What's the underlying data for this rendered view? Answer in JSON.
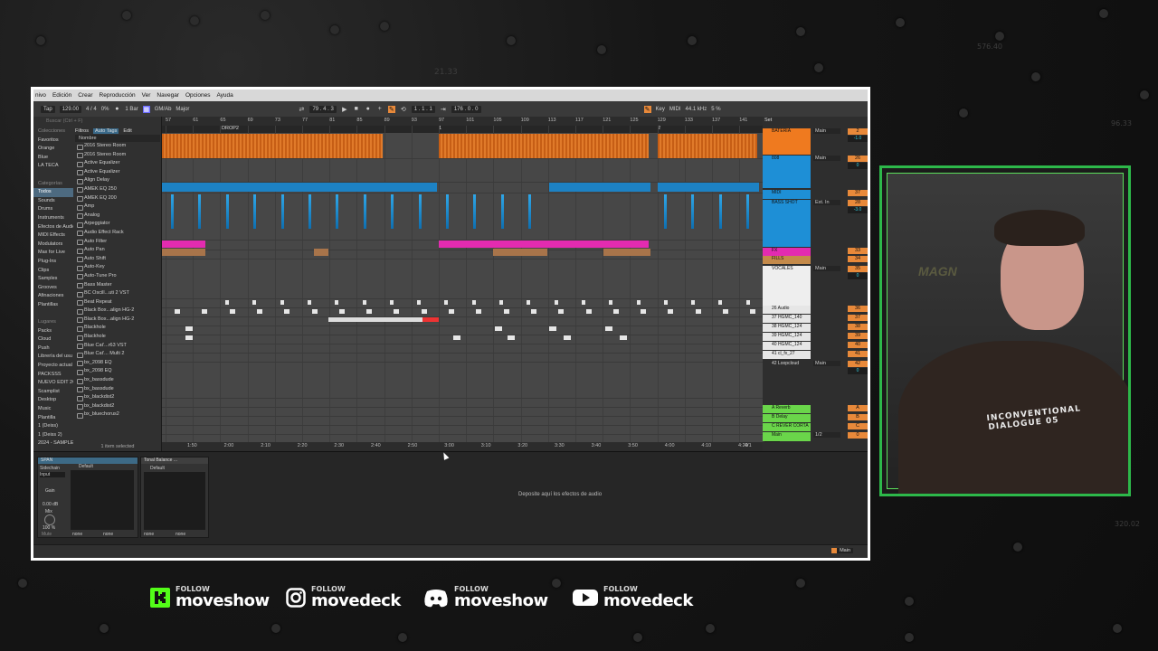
{
  "background": {
    "numbers": [
      "21.33",
      "576.40",
      "96.33",
      "320.02"
    ]
  },
  "menubar": {
    "items": [
      "nivo",
      "Edición",
      "Crear",
      "Reproducción",
      "Ver",
      "Navegar",
      "Opciones",
      "Ayuda"
    ]
  },
  "toolbar": {
    "tap": "Tap",
    "tempo": "129.00",
    "signature": "4 / 4",
    "pct": "0%",
    "bar": "1 Bar",
    "key": "GM/Ab",
    "scale": "Major",
    "position": "79 . 4 . 3",
    "loop_start": "1 . 1 . 1",
    "loop_length": "176 . 0 . 0",
    "key_label": "Key",
    "midi": "MIDI",
    "sample_rate": "44.1 kHz",
    "cpu": "5 %"
  },
  "browser": {
    "search_placeholder": "Buscar (Ctrl + F)",
    "left": [
      "Colecciones",
      "Favoritos",
      "Orange",
      "Blue",
      "LA TECA",
      "",
      "Categorías",
      "Todos",
      "Sounds",
      "Drums",
      "Instruments",
      "Efectos de Audio",
      "MIDI Effects",
      "Modulators",
      "Max for Live",
      "Plug-Ins",
      "Clips",
      "Samples",
      "Grooves",
      "Afinaciones",
      "Plantillas",
      "",
      "Lugares",
      "Packs",
      "Cloud",
      "Push",
      "Librería del usu",
      "Proyecto actual",
      "PACKSSS",
      "NUEVO EDIT 2C",
      "Scamplist",
      "Desktop",
      "Music",
      "Plantilla",
      "1 (Deiss)",
      "1 (Deiss 2)",
      "2024 - SAMPLE"
    ],
    "left_selected": 7,
    "filters": "Filtros",
    "auto_tags": "Auto Tags",
    "edit": "Edit",
    "name_col": "Nombre",
    "items": [
      "2016 Stereo Room",
      "2016 Stereo Room",
      "Active Equalizer",
      "Active Equalizer",
      "Align Delay",
      "AMEK EQ 250",
      "AMEK EQ 200",
      "Amp",
      "Analog",
      "Arpeggiator",
      "Audio Effect Rack",
      "Auto Filter",
      "Auto Pan",
      "Auto Shift",
      "Auto-Key",
      "Auto-Tune Pro",
      "Bass Master",
      "BC Oscill...uti 2 VST",
      "Beat Repeat",
      "Black Box...align HG-2",
      "Black Box...align HG-2",
      "Blackhole",
      "Blackhole",
      "Blue Cat'...r63 VST",
      "Blue Cat'... Multi 2",
      "bx_2098 EQ",
      "bx_2098 EQ",
      "bx_bassdude",
      "bx_bassdude",
      "bx_blackdist2",
      "bx_blackdist2",
      "bx_bluechorus2"
    ],
    "footer": "1 item selected"
  },
  "arrangement": {
    "bars": [
      "57",
      "61",
      "65",
      "69",
      "73",
      "77",
      "81",
      "85",
      "89",
      "93",
      "97",
      "101",
      "105",
      "109",
      "113",
      "117",
      "121",
      "125",
      "129",
      "133",
      "137",
      "141"
    ],
    "locators": [
      "DROP2",
      "1",
      "2"
    ],
    "times": [
      "1:50",
      "2:00",
      "2:10",
      "2:20",
      "2:30",
      "2:40",
      "2:50",
      "3:00",
      "3:10",
      "3:20",
      "3:30",
      "3:40",
      "3:50",
      "4:00",
      "4:10",
      "4:20"
    ],
    "zoom": "4/1"
  },
  "mixer": {
    "set_label": "Set",
    "tracks": [
      {
        "name": "BATERIA",
        "color": "#ef7a1f",
        "io": "Main",
        "num": "2",
        "vol": "-1.0"
      },
      {
        "name": "808",
        "color": "#1e8fd6",
        "io": "Main",
        "num": "26",
        "vol": "0"
      },
      {
        "name": "MIDI",
        "color": "#1e8fd6",
        "io": "",
        "num": "37",
        "vol": ""
      },
      {
        "name": "BASS SHOT",
        "color": "#1e8fd6",
        "io": "Ext. In",
        "num": "28",
        "vol": "-3.0"
      },
      {
        "name": "FX",
        "color": "#e32bb0",
        "io": "",
        "num": "33",
        "vol": ""
      },
      {
        "name": "FILLS",
        "color": "#c48a4a",
        "io": "",
        "num": "34",
        "vol": ""
      },
      {
        "name": "VOCALES",
        "color": "#eeeeee",
        "io": "Main",
        "num": "35",
        "vol": "0"
      },
      {
        "name": "26 Audio",
        "color": "#e6e6e6",
        "io": "",
        "num": "36",
        "vol": ""
      },
      {
        "name": "37 HGMC_140",
        "color": "#e6e6e6",
        "io": "",
        "num": "37",
        "vol": ""
      },
      {
        "name": "38 HGMC_124",
        "color": "#e6e6e6",
        "io": "",
        "num": "38",
        "vol": ""
      },
      {
        "name": "39 HGMC_124",
        "color": "#e6e6e6",
        "io": "",
        "num": "39",
        "vol": ""
      },
      {
        "name": "40 HGMC_124",
        "color": "#e6e6e6",
        "io": "",
        "num": "40",
        "vol": ""
      },
      {
        "name": "41 cl_fx_27",
        "color": "#e6e6e6",
        "io": "",
        "num": "41",
        "vol": ""
      },
      {
        "name": "42 Loopcloud",
        "color": "#2e2e2e",
        "io": "Main",
        "num": "42",
        "vol": "0"
      },
      {
        "name": "A Reverb",
        "color": "#6ad64a",
        "io": "",
        "num": "A",
        "vol": ""
      },
      {
        "name": "B Delay",
        "color": "#6ad64a",
        "io": "",
        "num": "B",
        "vol": ""
      },
      {
        "name": "C REVER CORTA",
        "color": "#6ad64a",
        "io": "",
        "num": "C",
        "vol": ""
      },
      {
        "name": "Main",
        "color": "#6ad64a",
        "io": "1/2",
        "num": "0",
        "vol": ""
      }
    ],
    "zoom_factor": "2.00x"
  },
  "detail": {
    "device1": {
      "title": "SPAN",
      "chain": "Sidechain",
      "input": "Input",
      "gain": "Gain",
      "gain_val": "0.00 dB",
      "mix": "Mix",
      "mix_val": "100 %",
      "mute": "Mute",
      "none1": "none",
      "none2": "none"
    },
    "device2": {
      "title": "Default"
    },
    "device3": {
      "title": "Tonal Balance ...",
      "sub": "Default",
      "none1": "none",
      "none2": "none"
    },
    "drop_text": "Deposite aquí los efectos de audio",
    "status_main": "Main"
  },
  "socials": [
    {
      "platform": "kick-icon",
      "follow": "FOLLOW",
      "name": "moveshow"
    },
    {
      "platform": "instagram-icon",
      "follow": "FOLLOW",
      "name": "movedeck"
    },
    {
      "platform": "discord-icon",
      "follow": "FOLLOW",
      "name": "moveshow"
    },
    {
      "platform": "youtube-icon",
      "follow": "FOLLOW",
      "name": "movedeck"
    }
  ],
  "webcam": {
    "shirt_text": "INCONVENTIONAL DIALOGUE 05",
    "poster_text": "MAGN"
  }
}
